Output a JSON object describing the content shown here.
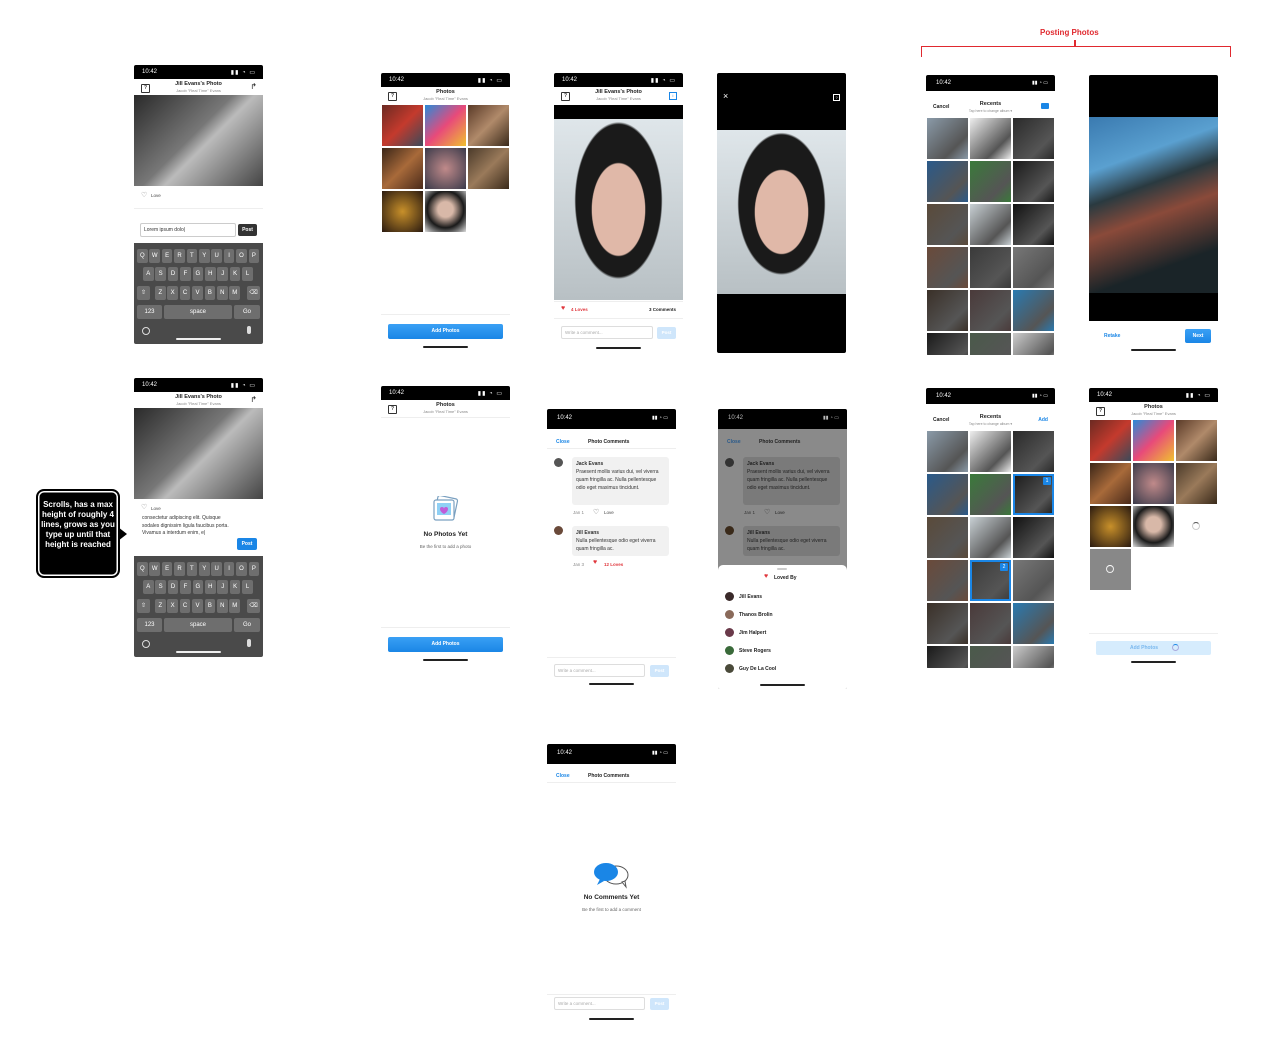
{
  "status_time": "10:42",
  "posting_label": "Posting Photos",
  "callout_text": "Scrolls, has a max height of roughly 4 lines, grows as you type up until that height is reached",
  "photo_screen": {
    "title": "Jill Evans's Photo",
    "subtitle": "Jacob \"Real Time\" Evans",
    "love_label": "Love",
    "input_value_1": "Lorem ipsum dolo|",
    "input_value_2": "consectetur adipiscing elit. Quisque sodales dignissim ligula faucibus porta. Vivamus a interdum enim, e|",
    "post_label": "Post"
  },
  "keyboard": {
    "row1": [
      "Q",
      "W",
      "E",
      "R",
      "T",
      "Y",
      "U",
      "I",
      "O",
      "P"
    ],
    "row2": [
      "A",
      "S",
      "D",
      "F",
      "G",
      "H",
      "J",
      "K",
      "L"
    ],
    "row3": [
      "Z",
      "X",
      "C",
      "V",
      "B",
      "N",
      "M"
    ],
    "shift": "⇧",
    "backspace": "⌫",
    "num_label": "123",
    "space_label": "space",
    "go_label": "Go",
    "emoji_icon": "emoji-icon",
    "mic_icon": "mic-icon"
  },
  "gallery": {
    "title": "Photos",
    "subtitle": "Jacob \"Real Time\" Evans",
    "add_label": "Add Photos",
    "empty_title": "No Photos Yet",
    "empty_sub": "Be the first to add a photo"
  },
  "detail": {
    "title": "Jill Evans's Photo",
    "subtitle": "Jacob \"Real Time\" Evans",
    "loves": "4 Loves",
    "comments_count": "3 Comments",
    "placeholder": "Write a comment...",
    "post_label": "Post"
  },
  "comments": {
    "close_label": "Close",
    "title": "Photo Comments",
    "items": [
      {
        "author": "Jack Evans",
        "text": "Praesent mollis varius dui, vel viverra quam fringilla ac. Nulla pellentesque odio eget maximus tincidunt.",
        "date": "Jan 1",
        "love": "Love"
      },
      {
        "author": "Jill Evans",
        "text": "Nulla pellentesque odio eget viverra quam fringilla ac.",
        "date": "Jan 3",
        "love": "12 Loves"
      }
    ],
    "placeholder": "Write a comment...",
    "post_label": "Post",
    "empty_title": "No Comments Yet",
    "empty_sub": "Be the first to add a comment"
  },
  "loved_by": {
    "title": "Loved By",
    "people": [
      "Jill Evans",
      "Thanos Brolin",
      "Jim Halpert",
      "Steve Rogers",
      "Guy De La Cool"
    ]
  },
  "picker": {
    "cancel_label": "Cancel",
    "title": "Recents",
    "subtitle": "Tap here to change album ▾",
    "add_label": "Add",
    "badge_1": "1",
    "badge_2": "2"
  },
  "camera": {
    "retake_label": "Retake",
    "next_label": "Next"
  },
  "colors": {
    "accent": "#1a86e6",
    "love_red": "#e0363c",
    "annotation_red": "#e0292f"
  }
}
